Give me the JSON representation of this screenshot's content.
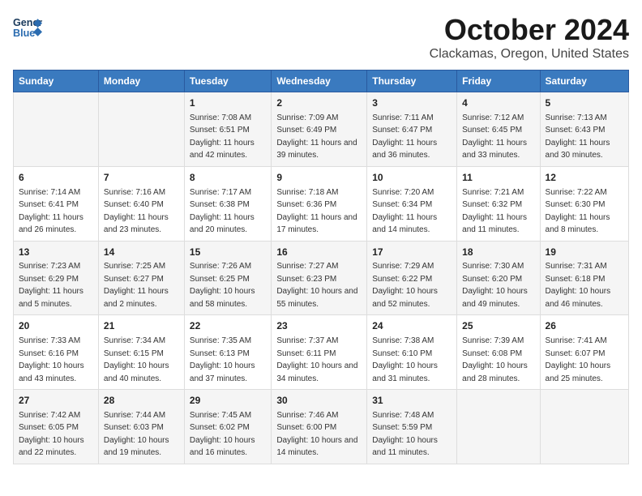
{
  "header": {
    "logo_line1": "General",
    "logo_line2": "Blue",
    "title": "October 2024",
    "subtitle": "Clackamas, Oregon, United States"
  },
  "days_of_week": [
    "Sunday",
    "Monday",
    "Tuesday",
    "Wednesday",
    "Thursday",
    "Friday",
    "Saturday"
  ],
  "weeks": [
    [
      {
        "day": "",
        "sunrise": "",
        "sunset": "",
        "daylight": ""
      },
      {
        "day": "",
        "sunrise": "",
        "sunset": "",
        "daylight": ""
      },
      {
        "day": "1",
        "sunrise": "Sunrise: 7:08 AM",
        "sunset": "Sunset: 6:51 PM",
        "daylight": "Daylight: 11 hours and 42 minutes."
      },
      {
        "day": "2",
        "sunrise": "Sunrise: 7:09 AM",
        "sunset": "Sunset: 6:49 PM",
        "daylight": "Daylight: 11 hours and 39 minutes."
      },
      {
        "day": "3",
        "sunrise": "Sunrise: 7:11 AM",
        "sunset": "Sunset: 6:47 PM",
        "daylight": "Daylight: 11 hours and 36 minutes."
      },
      {
        "day": "4",
        "sunrise": "Sunrise: 7:12 AM",
        "sunset": "Sunset: 6:45 PM",
        "daylight": "Daylight: 11 hours and 33 minutes."
      },
      {
        "day": "5",
        "sunrise": "Sunrise: 7:13 AM",
        "sunset": "Sunset: 6:43 PM",
        "daylight": "Daylight: 11 hours and 30 minutes."
      }
    ],
    [
      {
        "day": "6",
        "sunrise": "Sunrise: 7:14 AM",
        "sunset": "Sunset: 6:41 PM",
        "daylight": "Daylight: 11 hours and 26 minutes."
      },
      {
        "day": "7",
        "sunrise": "Sunrise: 7:16 AM",
        "sunset": "Sunset: 6:40 PM",
        "daylight": "Daylight: 11 hours and 23 minutes."
      },
      {
        "day": "8",
        "sunrise": "Sunrise: 7:17 AM",
        "sunset": "Sunset: 6:38 PM",
        "daylight": "Daylight: 11 hours and 20 minutes."
      },
      {
        "day": "9",
        "sunrise": "Sunrise: 7:18 AM",
        "sunset": "Sunset: 6:36 PM",
        "daylight": "Daylight: 11 hours and 17 minutes."
      },
      {
        "day": "10",
        "sunrise": "Sunrise: 7:20 AM",
        "sunset": "Sunset: 6:34 PM",
        "daylight": "Daylight: 11 hours and 14 minutes."
      },
      {
        "day": "11",
        "sunrise": "Sunrise: 7:21 AM",
        "sunset": "Sunset: 6:32 PM",
        "daylight": "Daylight: 11 hours and 11 minutes."
      },
      {
        "day": "12",
        "sunrise": "Sunrise: 7:22 AM",
        "sunset": "Sunset: 6:30 PM",
        "daylight": "Daylight: 11 hours and 8 minutes."
      }
    ],
    [
      {
        "day": "13",
        "sunrise": "Sunrise: 7:23 AM",
        "sunset": "Sunset: 6:29 PM",
        "daylight": "Daylight: 11 hours and 5 minutes."
      },
      {
        "day": "14",
        "sunrise": "Sunrise: 7:25 AM",
        "sunset": "Sunset: 6:27 PM",
        "daylight": "Daylight: 11 hours and 2 minutes."
      },
      {
        "day": "15",
        "sunrise": "Sunrise: 7:26 AM",
        "sunset": "Sunset: 6:25 PM",
        "daylight": "Daylight: 10 hours and 58 minutes."
      },
      {
        "day": "16",
        "sunrise": "Sunrise: 7:27 AM",
        "sunset": "Sunset: 6:23 PM",
        "daylight": "Daylight: 10 hours and 55 minutes."
      },
      {
        "day": "17",
        "sunrise": "Sunrise: 7:29 AM",
        "sunset": "Sunset: 6:22 PM",
        "daylight": "Daylight: 10 hours and 52 minutes."
      },
      {
        "day": "18",
        "sunrise": "Sunrise: 7:30 AM",
        "sunset": "Sunset: 6:20 PM",
        "daylight": "Daylight: 10 hours and 49 minutes."
      },
      {
        "day": "19",
        "sunrise": "Sunrise: 7:31 AM",
        "sunset": "Sunset: 6:18 PM",
        "daylight": "Daylight: 10 hours and 46 minutes."
      }
    ],
    [
      {
        "day": "20",
        "sunrise": "Sunrise: 7:33 AM",
        "sunset": "Sunset: 6:16 PM",
        "daylight": "Daylight: 10 hours and 43 minutes."
      },
      {
        "day": "21",
        "sunrise": "Sunrise: 7:34 AM",
        "sunset": "Sunset: 6:15 PM",
        "daylight": "Daylight: 10 hours and 40 minutes."
      },
      {
        "day": "22",
        "sunrise": "Sunrise: 7:35 AM",
        "sunset": "Sunset: 6:13 PM",
        "daylight": "Daylight: 10 hours and 37 minutes."
      },
      {
        "day": "23",
        "sunrise": "Sunrise: 7:37 AM",
        "sunset": "Sunset: 6:11 PM",
        "daylight": "Daylight: 10 hours and 34 minutes."
      },
      {
        "day": "24",
        "sunrise": "Sunrise: 7:38 AM",
        "sunset": "Sunset: 6:10 PM",
        "daylight": "Daylight: 10 hours and 31 minutes."
      },
      {
        "day": "25",
        "sunrise": "Sunrise: 7:39 AM",
        "sunset": "Sunset: 6:08 PM",
        "daylight": "Daylight: 10 hours and 28 minutes."
      },
      {
        "day": "26",
        "sunrise": "Sunrise: 7:41 AM",
        "sunset": "Sunset: 6:07 PM",
        "daylight": "Daylight: 10 hours and 25 minutes."
      }
    ],
    [
      {
        "day": "27",
        "sunrise": "Sunrise: 7:42 AM",
        "sunset": "Sunset: 6:05 PM",
        "daylight": "Daylight: 10 hours and 22 minutes."
      },
      {
        "day": "28",
        "sunrise": "Sunrise: 7:44 AM",
        "sunset": "Sunset: 6:03 PM",
        "daylight": "Daylight: 10 hours and 19 minutes."
      },
      {
        "day": "29",
        "sunrise": "Sunrise: 7:45 AM",
        "sunset": "Sunset: 6:02 PM",
        "daylight": "Daylight: 10 hours and 16 minutes."
      },
      {
        "day": "30",
        "sunrise": "Sunrise: 7:46 AM",
        "sunset": "Sunset: 6:00 PM",
        "daylight": "Daylight: 10 hours and 14 minutes."
      },
      {
        "day": "31",
        "sunrise": "Sunrise: 7:48 AM",
        "sunset": "Sunset: 5:59 PM",
        "daylight": "Daylight: 10 hours and 11 minutes."
      },
      {
        "day": "",
        "sunrise": "",
        "sunset": "",
        "daylight": ""
      },
      {
        "day": "",
        "sunrise": "",
        "sunset": "",
        "daylight": ""
      }
    ]
  ]
}
